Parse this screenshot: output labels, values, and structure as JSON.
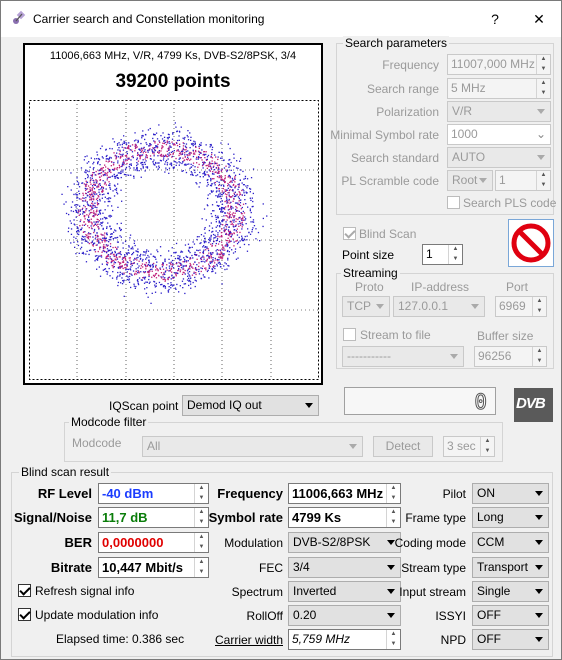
{
  "window": {
    "title": "Carrier search and Constellation monitoring",
    "help": "?",
    "close": "✕"
  },
  "constellation": {
    "header": "11006,663 MHz, V/R, 4799 Ks, DVB-S2/8PSK, 3/4",
    "points_label": "39200 points",
    "point_color": "#2b1fc9",
    "hot_color": "#c0207a"
  },
  "search": {
    "title": "Search parameters",
    "frequency_label": "Frequency",
    "frequency": "11007,000 MHz",
    "range_label": "Search range",
    "range": "5 MHz",
    "polarization_label": "Polarization",
    "polarization": "V/R",
    "min_sr_label": "Minimal Symbol rate",
    "min_sr": "1000",
    "standard_label": "Search standard",
    "standard": "AUTO",
    "pl_label": "PL Scramble code",
    "pl_mode": "Root",
    "pl_value": "1",
    "pls_label": "Search PLS code"
  },
  "blind_scan_label": "Blind Scan",
  "point_size_label": "Point size",
  "point_size": "1",
  "streaming": {
    "title": "Streaming",
    "proto_label": "Proto",
    "ip_label": "IP-address",
    "port_label": "Port",
    "proto": "TCP",
    "ip": "127.0.0.1",
    "port": "6969",
    "file_label": "Stream to file",
    "buffer_label": "Buffer size",
    "file_value": "-----------",
    "buffer": "96256"
  },
  "counter": "0",
  "dvb_logo": "DVB",
  "iqscan_label": "IQScan point",
  "iqscan": "Demod IQ out",
  "modcode": {
    "title": "Modcode filter",
    "label": "Modcode",
    "value": "All",
    "detect": "Detect",
    "timeout": "3 sec"
  },
  "result": {
    "title": "Blind scan result",
    "rf_label": "RF Level",
    "rf": "-40 dBm",
    "sn_label": "Signal/Noise",
    "sn": "11,7 dB",
    "ber_label": "BER",
    "ber": "0,0000000",
    "bitrate_label": "Bitrate",
    "bitrate": "10,447 Mbit/s",
    "freq_label": "Frequency",
    "freq": "11006,663 MHz",
    "sr_label": "Symbol rate",
    "sr": "4799 Ks",
    "mod_label": "Modulation",
    "mod": "DVB-S2/8PSK",
    "fec_label": "FEC",
    "fec": "3/4",
    "spectrum_label": "Spectrum",
    "spectrum": "Inverted",
    "rolloff_label": "RollOff",
    "rolloff": "0.20",
    "cw_label": "Carrier width",
    "cw": "5,759 MHz",
    "pilot_label": "Pilot",
    "pilot": "ON",
    "frame_label": "Frame type",
    "frame": "Long",
    "coding_label": "Coding mode",
    "coding": "CCM",
    "stype_label": "Stream type",
    "stype": "Transport",
    "istream_label": "Input stream",
    "istream": "Single",
    "issyi_label": "ISSYI",
    "issyi": "OFF",
    "npd_label": "NPD",
    "npd": "OFF",
    "refresh_label": "Refresh signal info",
    "update_label": "Update modulation info",
    "elapsed": "Elapsed time: 0.386 sec",
    "rf_color": "#1a3cff",
    "sn_color": "#0a7d0a",
    "ber_color": "#e00000"
  }
}
